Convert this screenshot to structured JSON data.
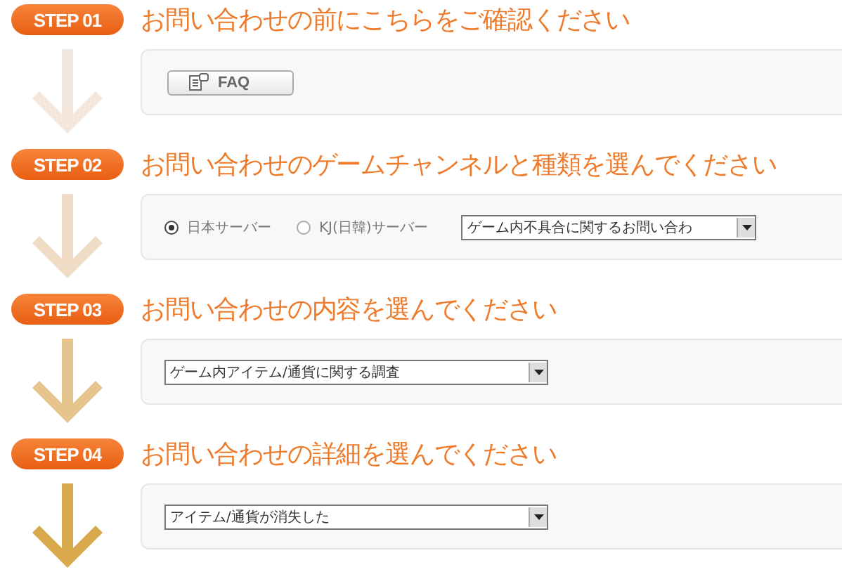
{
  "steps": [
    {
      "badge": "STEP 01",
      "title": "お問い合わせの前にこちらをご確認ください",
      "color": "#f3e6dc",
      "content": {
        "kind": "button",
        "label": "FAQ"
      }
    },
    {
      "badge": "STEP 02",
      "title": "お問い合わせのゲームチャンネルと種類を選んでください",
      "color": "#f0dcc4",
      "content": {
        "kind": "radio_select",
        "options": [
          {
            "label": "日本サーバー",
            "selected": true
          },
          {
            "label": "KJ(日韓)サーバー",
            "selected": false
          }
        ],
        "select": "ゲーム内不具合に関するお問い合わ"
      }
    },
    {
      "badge": "STEP 03",
      "title": "お問い合わせの内容を選んでください",
      "color": "#e6c48e",
      "content": {
        "kind": "select",
        "select": "ゲーム内アイテム/通貨に関する調査"
      }
    },
    {
      "badge": "STEP 04",
      "title": "お問い合わせの詳細を選んでください",
      "color": "#d9a94e",
      "content": {
        "kind": "select",
        "select": "アイテム/通貨が消失した"
      }
    }
  ]
}
